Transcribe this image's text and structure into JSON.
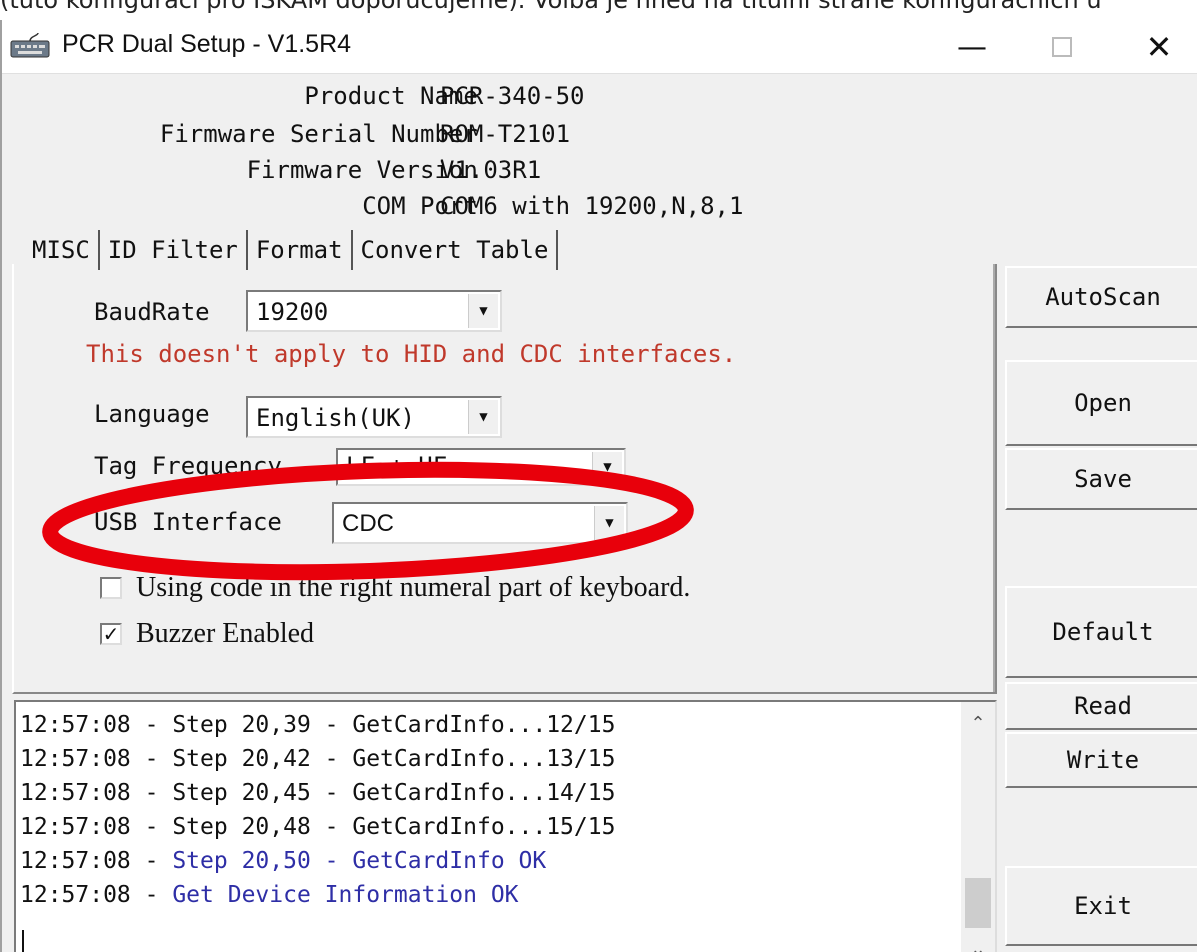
{
  "page_top_text": "(tuto konfiguraci pro ISKAM doporučujeme). Volba je hned na titulní straně konfiguračních ú",
  "window": {
    "title": "PCR Dual Setup - V1.5R4",
    "minimize_glyph": "—",
    "close_glyph": "✕"
  },
  "device_info": [
    {
      "label": "Product Name",
      "value": "PCR-340-50"
    },
    {
      "label": "Firmware Serial Number",
      "value": "ROM-T2101"
    },
    {
      "label": "Firmware Version",
      "value": "V1.03R1"
    },
    {
      "label": "COM Port",
      "value": "COM6 with 19200,N,8,1"
    }
  ],
  "tabs": [
    "MISC",
    "ID Filter",
    "Format",
    "Convert Table"
  ],
  "misc": {
    "baudrate": {
      "label": "BaudRate",
      "value": "19200"
    },
    "baud_note": "This doesn't apply to HID and CDC interfaces.",
    "language": {
      "label": "Language",
      "value": "English(UK)"
    },
    "tag_frequency": {
      "label": "Tag Frequency",
      "value": "LF + HF"
    },
    "usb_interface": {
      "label": "USB Interface",
      "value": "CDC"
    },
    "checkbox_numeral": {
      "label": "Using code in the right numeral part of keyboard.",
      "checked": false
    },
    "checkbox_buzzer": {
      "label": "Buzzer Enabled",
      "checked": true
    }
  },
  "side_buttons": {
    "autoscan": "AutoScan",
    "open": "Open",
    "save": "Save",
    "default": "Default",
    "read": "Read",
    "write": "Write",
    "exit": "Exit"
  },
  "log": [
    {
      "time": "12:57:08",
      "sep": " - ",
      "text": "Step 20,39 - GetCardInfo...12/15",
      "color": "#111111"
    },
    {
      "time": "12:57:08",
      "sep": " - ",
      "text": "Step 20,42 - GetCardInfo...13/15",
      "color": "#111111"
    },
    {
      "time": "12:57:08",
      "sep": " - ",
      "text": "Step 20,45 - GetCardInfo...14/15",
      "color": "#111111"
    },
    {
      "time": "12:57:08",
      "sep": " - ",
      "text": "Step 20,48 - GetCardInfo...15/15",
      "color": "#111111"
    },
    {
      "time": "12:57:08",
      "sep": " - ",
      "text": "Step 20,50 - GetCardInfo OK",
      "color": "#2e2ea6"
    },
    {
      "time": "12:57:08",
      "sep": " - ",
      "text": "Get Device Information OK",
      "color": "#2e2ea6"
    }
  ],
  "colors": {
    "warning": "#c0392b",
    "log_ok": "#2e2ea6",
    "highlight_ellipse": "#e8000b"
  }
}
